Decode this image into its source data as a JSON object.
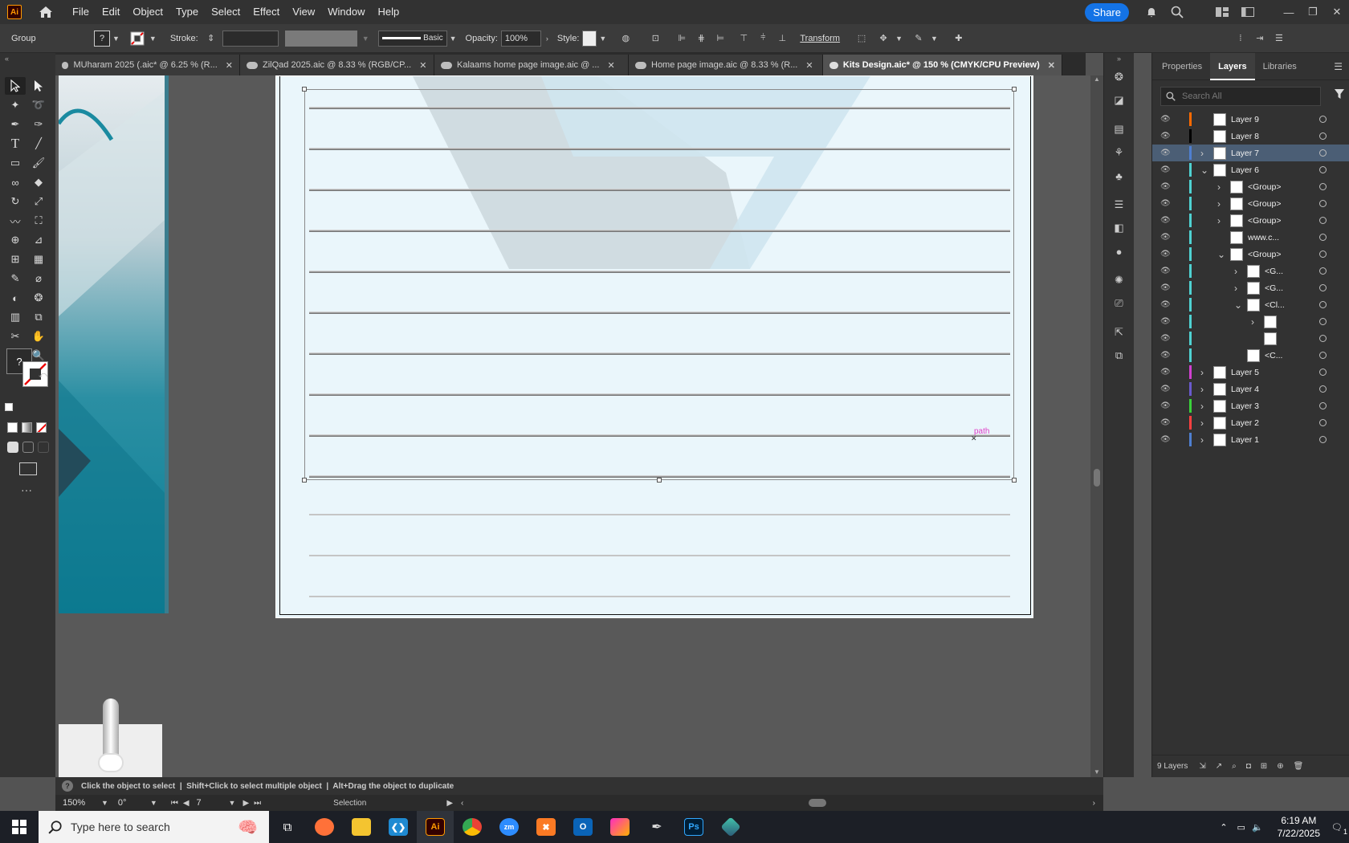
{
  "menubar": {
    "logo": "Ai",
    "items": [
      "File",
      "Edit",
      "Object",
      "Type",
      "Select",
      "Effect",
      "View",
      "Window",
      "Help"
    ],
    "share": "Share"
  },
  "controlbar": {
    "selection_type": "Group",
    "fill_value": "?",
    "stroke_label": "Stroke:",
    "brush_label": "Basic",
    "opacity_label": "Opacity:",
    "opacity_value": "100%",
    "style_label": "Style:",
    "transform_label": "Transform"
  },
  "tabs": [
    {
      "label": "MUharam 2025 (.aic* @ 6.25 % (R...",
      "active": false
    },
    {
      "label": "ZilQad 2025.aic @ 8.33 % (RGB/CP...",
      "active": false
    },
    {
      "label": "Kalaams home page image.aic @ ...",
      "active": false
    },
    {
      "label": "Home page image.aic @ 8.33 % (R...",
      "active": false
    },
    {
      "label": "Kits Design.aic* @ 150 % (CMYK/CPU Preview)",
      "active": true
    }
  ],
  "canvas": {
    "path_label": "path"
  },
  "layers_panel": {
    "tabs": [
      "Properties",
      "Layers",
      "Libraries"
    ],
    "active_tab": "Layers",
    "search_placeholder": "Search All",
    "rows": [
      {
        "name": "Layer 9",
        "color": "#ff6a00",
        "depth": 0,
        "arrow": "",
        "selected": false
      },
      {
        "name": "Layer 8",
        "color": "#000000",
        "depth": 0,
        "arrow": "",
        "selected": false
      },
      {
        "name": "Layer 7",
        "color": "#4f7fd0",
        "depth": 0,
        "arrow": ">",
        "selected": true
      },
      {
        "name": "Layer 6",
        "color": "#4fd1d1",
        "depth": 0,
        "arrow": "v",
        "selected": false
      },
      {
        "name": "<Group>",
        "color": "#4fd1d1",
        "depth": 1,
        "arrow": ">",
        "selected": false
      },
      {
        "name": "<Group>",
        "color": "#4fd1d1",
        "depth": 1,
        "arrow": ">",
        "selected": false
      },
      {
        "name": "<Group>",
        "color": "#4fd1d1",
        "depth": 1,
        "arrow": ">",
        "selected": false
      },
      {
        "name": "www.c...",
        "color": "#4fd1d1",
        "depth": 1,
        "arrow": "",
        "selected": false
      },
      {
        "name": "<Group>",
        "color": "#4fd1d1",
        "depth": 1,
        "arrow": "v",
        "selected": false
      },
      {
        "name": "<G...",
        "color": "#4fd1d1",
        "depth": 2,
        "arrow": ">",
        "selected": false
      },
      {
        "name": "<G...",
        "color": "#4fd1d1",
        "depth": 2,
        "arrow": ">",
        "selected": false
      },
      {
        "name": "<Cl...",
        "color": "#4fd1d1",
        "depth": 2,
        "arrow": "v",
        "selected": false
      },
      {
        "name": "",
        "color": "#4fd1d1",
        "depth": 3,
        "arrow": ">",
        "selected": false
      },
      {
        "name": "",
        "color": "#4fd1d1",
        "depth": 3,
        "arrow": "",
        "selected": false
      },
      {
        "name": "<C...",
        "color": "#4fd1d1",
        "depth": 2,
        "arrow": "",
        "selected": false
      },
      {
        "name": "Layer 5",
        "color": "#d040d0",
        "depth": 0,
        "arrow": ">",
        "selected": false
      },
      {
        "name": "Layer 4",
        "color": "#6a5acd",
        "depth": 0,
        "arrow": ">",
        "selected": false
      },
      {
        "name": "Layer 3",
        "color": "#3ad13a",
        "depth": 0,
        "arrow": ">",
        "selected": false
      },
      {
        "name": "Layer 2",
        "color": "#ff4040",
        "depth": 0,
        "arrow": ">",
        "selected": false
      },
      {
        "name": "Layer 1",
        "color": "#4f7fd0",
        "depth": 0,
        "arrow": ">",
        "selected": false
      }
    ],
    "footer_count": "9 Layers"
  },
  "status": {
    "hint": "Click the object to select  |  Shift+Click to select multiple object  |  Alt+Drag the object to duplicate",
    "zoom": "150%",
    "rotation": "0°",
    "artboard": "7",
    "tool": "Selection"
  },
  "taskbar": {
    "search_placeholder": "Type here to search",
    "time": "6:19 AM",
    "date": "7/22/2025",
    "notification_count": "1"
  }
}
